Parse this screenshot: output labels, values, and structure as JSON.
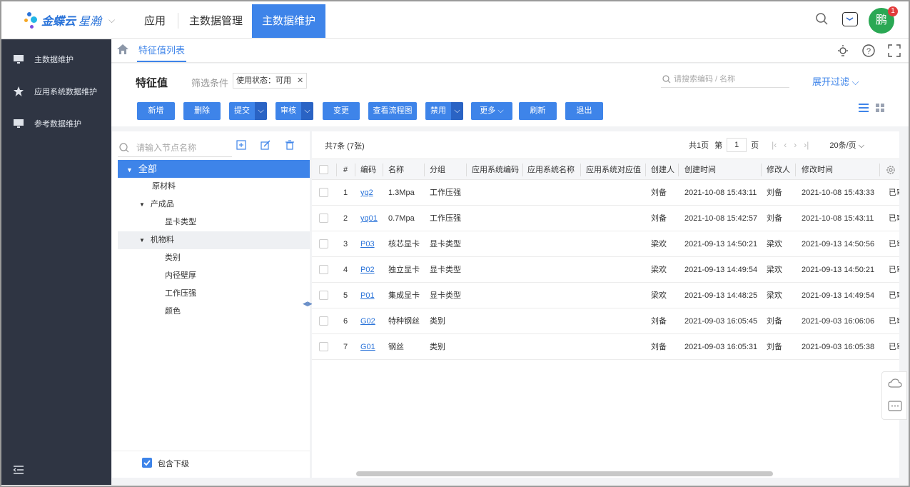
{
  "app": {
    "logo_brand": "金蝶云",
    "logo_product": "星瀚",
    "nav_tabs": [
      "应用",
      "主数据管理",
      "主数据维护"
    ],
    "avatar_text": "鹏",
    "notification_count": "1",
    "accent_color": "#3e84e9"
  },
  "sidebar": {
    "items": [
      {
        "label": "主数据维护",
        "icon": "monitor-icon"
      },
      {
        "label": "应用系统数据维护",
        "icon": "star-icon"
      },
      {
        "label": "参考数据维护",
        "icon": "monitor-icon"
      }
    ]
  },
  "tabbar": {
    "tab_title": "特征值列表"
  },
  "header": {
    "title": "特征值",
    "filter_label": "筛选条件",
    "filter_chip": "使用状态：可用",
    "search_placeholder": "请搜索编码 / 名称",
    "expand_filter": "展开过滤"
  },
  "toolbar": {
    "buttons": [
      "新增",
      "删除",
      "提交",
      "审核",
      "变更",
      "查看流程图",
      "禁用",
      "更多",
      "刷新",
      "退出"
    ]
  },
  "tree": {
    "search_placeholder": "请输入节点名称",
    "nodes": [
      {
        "label": "全部",
        "toggle": "▼"
      },
      {
        "label": "原材料",
        "toggle": ""
      },
      {
        "label": "产成品",
        "toggle": "▼"
      },
      {
        "label": "显卡类型",
        "toggle": ""
      },
      {
        "label": "机物料",
        "toggle": "▼"
      },
      {
        "label": "类别",
        "toggle": ""
      },
      {
        "label": "内径壁厚",
        "toggle": ""
      },
      {
        "label": "工作压强",
        "toggle": ""
      },
      {
        "label": "颜色",
        "toggle": ""
      }
    ],
    "include_sub_label": "包含下级"
  },
  "grid": {
    "count_text": "共7条 (7张)",
    "pager": {
      "total_pages": "共1页",
      "page_prefix": "第",
      "page_value": "1",
      "page_suffix": "页",
      "page_size": "20条/页"
    },
    "columns": [
      "#",
      "编码",
      "名称",
      "分组",
      "应用系统编码",
      "应用系统名称",
      "应用系统对应值",
      "创建人",
      "创建时间",
      "修改人",
      "修改时间"
    ],
    "rows": [
      {
        "no": "1",
        "code": "yq2",
        "name": "1.3Mpa",
        "group": "工作压强",
        "creator": "刘备",
        "created": "2021-10-08 15:43:11",
        "modifier": "刘备",
        "modified": "2021-10-08 15:43:33",
        "status": "已审"
      },
      {
        "no": "2",
        "code": "yq01",
        "name": "0.7Mpa",
        "group": "工作压强",
        "creator": "刘备",
        "created": "2021-10-08 15:42:57",
        "modifier": "刘备",
        "modified": "2021-10-08 15:43:11",
        "status": "已审"
      },
      {
        "no": "3",
        "code": "P03",
        "name": "核芯显卡",
        "group": "显卡类型",
        "creator": "梁欢",
        "created": "2021-09-13 14:50:21",
        "modifier": "梁欢",
        "modified": "2021-09-13 14:50:56",
        "status": "已审"
      },
      {
        "no": "4",
        "code": "P02",
        "name": "独立显卡",
        "group": "显卡类型",
        "creator": "梁欢",
        "created": "2021-09-13 14:49:54",
        "modifier": "梁欢",
        "modified": "2021-09-13 14:50:21",
        "status": "已审"
      },
      {
        "no": "5",
        "code": "P01",
        "name": "集成显卡",
        "group": "显卡类型",
        "creator": "梁欢",
        "created": "2021-09-13 14:48:25",
        "modifier": "梁欢",
        "modified": "2021-09-13 14:49:54",
        "status": "已审"
      },
      {
        "no": "6",
        "code": "G02",
        "name": "特种钢丝",
        "group": "类别",
        "creator": "刘备",
        "created": "2021-09-03 16:05:45",
        "modifier": "刘备",
        "modified": "2021-09-03 16:06:06",
        "status": "已审"
      },
      {
        "no": "7",
        "code": "G01",
        "name": "钢丝",
        "group": "类别",
        "creator": "刘备",
        "created": "2021-09-03 16:05:31",
        "modifier": "刘备",
        "modified": "2021-09-03 16:05:38",
        "status": "已审"
      }
    ]
  }
}
